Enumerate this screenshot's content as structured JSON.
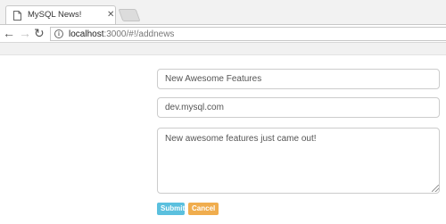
{
  "browser": {
    "tab": {
      "title": "MySQL News!",
      "close_glyph": "✕",
      "icon": "page-icon"
    },
    "new_tab_icon": "new-tab-icon",
    "nav": {
      "back_glyph": "←",
      "forward_glyph": "→",
      "reload_glyph": "↻"
    },
    "address": {
      "info_glyph": "i",
      "host": "localhost",
      "rest": ":3000/#!/addnews"
    }
  },
  "form": {
    "title_value": "New Awesome Features",
    "url_value": "dev.mysql.com",
    "text_value": "New awesome features just came out!",
    "submit_label": "Submit",
    "cancel_label": "Cancel"
  },
  "colors": {
    "submit": "#5bc0de",
    "cancel": "#f0ad4e"
  }
}
